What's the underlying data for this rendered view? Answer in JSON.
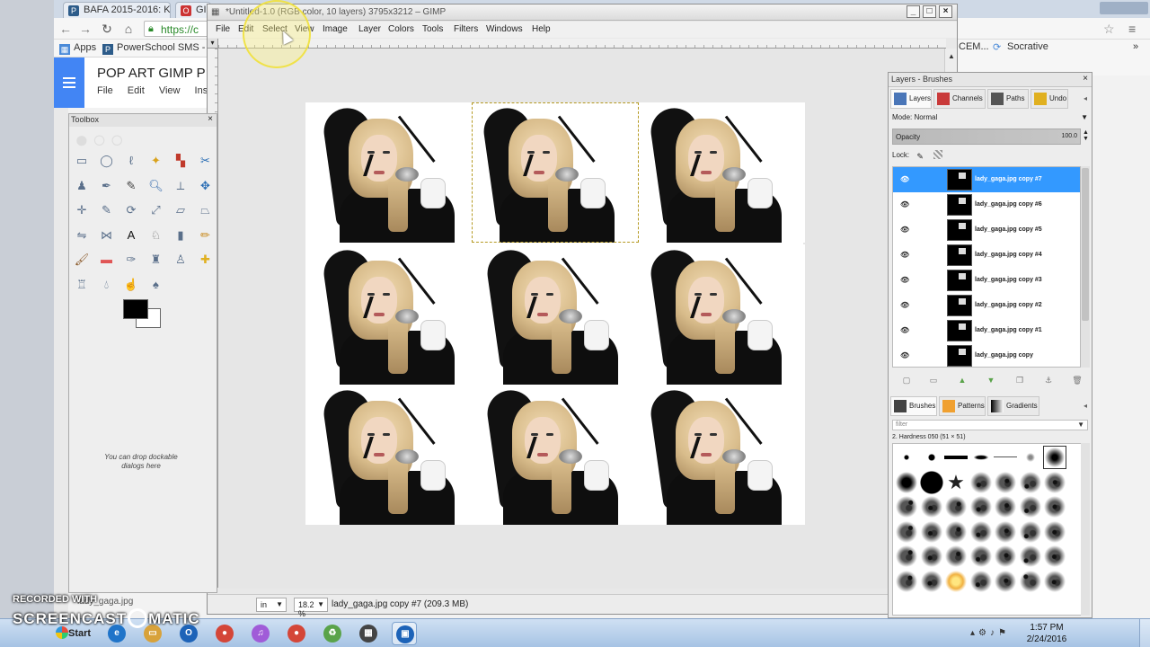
{
  "browser": {
    "tabs": [
      {
        "label": "BAFA 2015-2016: K",
        "favicon": "P",
        "color": "#2d5c8a"
      },
      {
        "label": "GI",
        "favicon": "O",
        "color": "#cc3333"
      }
    ],
    "url": "https://c",
    "bookmarks": [
      "Apps",
      "PowerSchool SMS -"
    ],
    "bookmark_right_1": "CEM...",
    "bookmark_right_2": "Socrative",
    "docs_title": "POP ART GIMP P",
    "docs_menu": [
      "File",
      "Edit",
      "View",
      "Inse"
    ]
  },
  "gimp": {
    "title": "*Untitled-1.0 (RGB color, 10 layers) 3795x3212 – GIMP",
    "menu": [
      "File",
      "Edit",
      "Select",
      "View",
      "Image",
      "Layer",
      "Colors",
      "Tools",
      "Filters",
      "Windows",
      "Help"
    ],
    "status": {
      "unit": "in",
      "zoom": "18.2 %",
      "message": "lady_gaga.jpg copy #7 (209.3 MB)"
    }
  },
  "toolbox": {
    "title": "Toolbox",
    "drop_hint": "You can drop dockable dialogs here",
    "tools": [
      "rect-select",
      "ellipse-select",
      "free-select",
      "fuzzy-select",
      "color-select",
      "scissors",
      "foreground-select",
      "paths",
      "color-picker",
      "zoom",
      "measure",
      "move",
      "align",
      "crop",
      "rotate",
      "scale",
      "shear",
      "perspective",
      "flip",
      "cage",
      "text",
      "bucket-fill",
      "blend",
      "pencil",
      "paintbrush",
      "eraser",
      "airbrush",
      "ink",
      "clone",
      "heal",
      "perspective-clone",
      "blur",
      "smudge",
      "dodge-burn"
    ]
  },
  "dock": {
    "title": "Layers - Brushes",
    "tabs": [
      {
        "label": "Layers",
        "icon": "layers-icon",
        "color": "#4a76b8"
      },
      {
        "label": "Channels",
        "icon": "channels-icon",
        "color": "#c93a3a"
      },
      {
        "label": "Paths",
        "icon": "paths-icon",
        "color": "#555555"
      },
      {
        "label": "Undo",
        "icon": "undo-icon",
        "color": "#e0b020"
      }
    ],
    "mode": "Mode: Normal",
    "opacity_label": "Opacity",
    "opacity_value": "100.0",
    "lock_label": "Lock:",
    "layers": [
      {
        "name": "lady_gaga.jpg copy #7",
        "active": true
      },
      {
        "name": "lady_gaga.jpg copy #6",
        "active": false
      },
      {
        "name": "lady_gaga.jpg copy #5",
        "active": false
      },
      {
        "name": "lady_gaga.jpg copy #4",
        "active": false
      },
      {
        "name": "lady_gaga.jpg copy #3",
        "active": false
      },
      {
        "name": "lady_gaga.jpg copy #2",
        "active": false
      },
      {
        "name": "lady_gaga.jpg copy #1",
        "active": false
      },
      {
        "name": "lady_gaga.jpg copy",
        "active": false
      }
    ],
    "brush_tabs": [
      {
        "label": "Brushes",
        "color": "#444444"
      },
      {
        "label": "Patterns",
        "color": "#f0a030"
      },
      {
        "label": "Gradients",
        "color": "#333333"
      }
    ],
    "filter_placeholder": "filter",
    "brush_name": "2. Hardness 050 (51 × 51)"
  },
  "hscroll_label": "lady_gaga.jpg",
  "taskbar": {
    "start": "Start",
    "apps": [
      {
        "name": "ie-icon",
        "color": "#1f74c9",
        "glyph": "e"
      },
      {
        "name": "file-explorer-icon",
        "color": "#d8a23a",
        "glyph": "▭"
      },
      {
        "name": "outlook-icon",
        "color": "#1d63b8",
        "glyph": "O"
      },
      {
        "name": "chrome-icon",
        "color": "#d44638",
        "glyph": "●"
      },
      {
        "name": "itunes-icon",
        "color": "#a05cd8",
        "glyph": "♫"
      },
      {
        "name": "chrome-icon-2",
        "color": "#d44638",
        "glyph": "●"
      },
      {
        "name": "recycle-icon",
        "color": "#5aa34a",
        "glyph": "♻"
      },
      {
        "name": "gimp-toolbox-icon",
        "color": "#444444",
        "glyph": "▦"
      },
      {
        "name": "gimp-image-icon",
        "color": "#1d63b8",
        "glyph": "▣",
        "active": true
      }
    ],
    "time": "1:57 PM",
    "date": "2/24/2016"
  },
  "watermark": {
    "line1": "RECORDED WITH",
    "line2a": "SCREENCAST",
    "line2b": "MATIC"
  }
}
